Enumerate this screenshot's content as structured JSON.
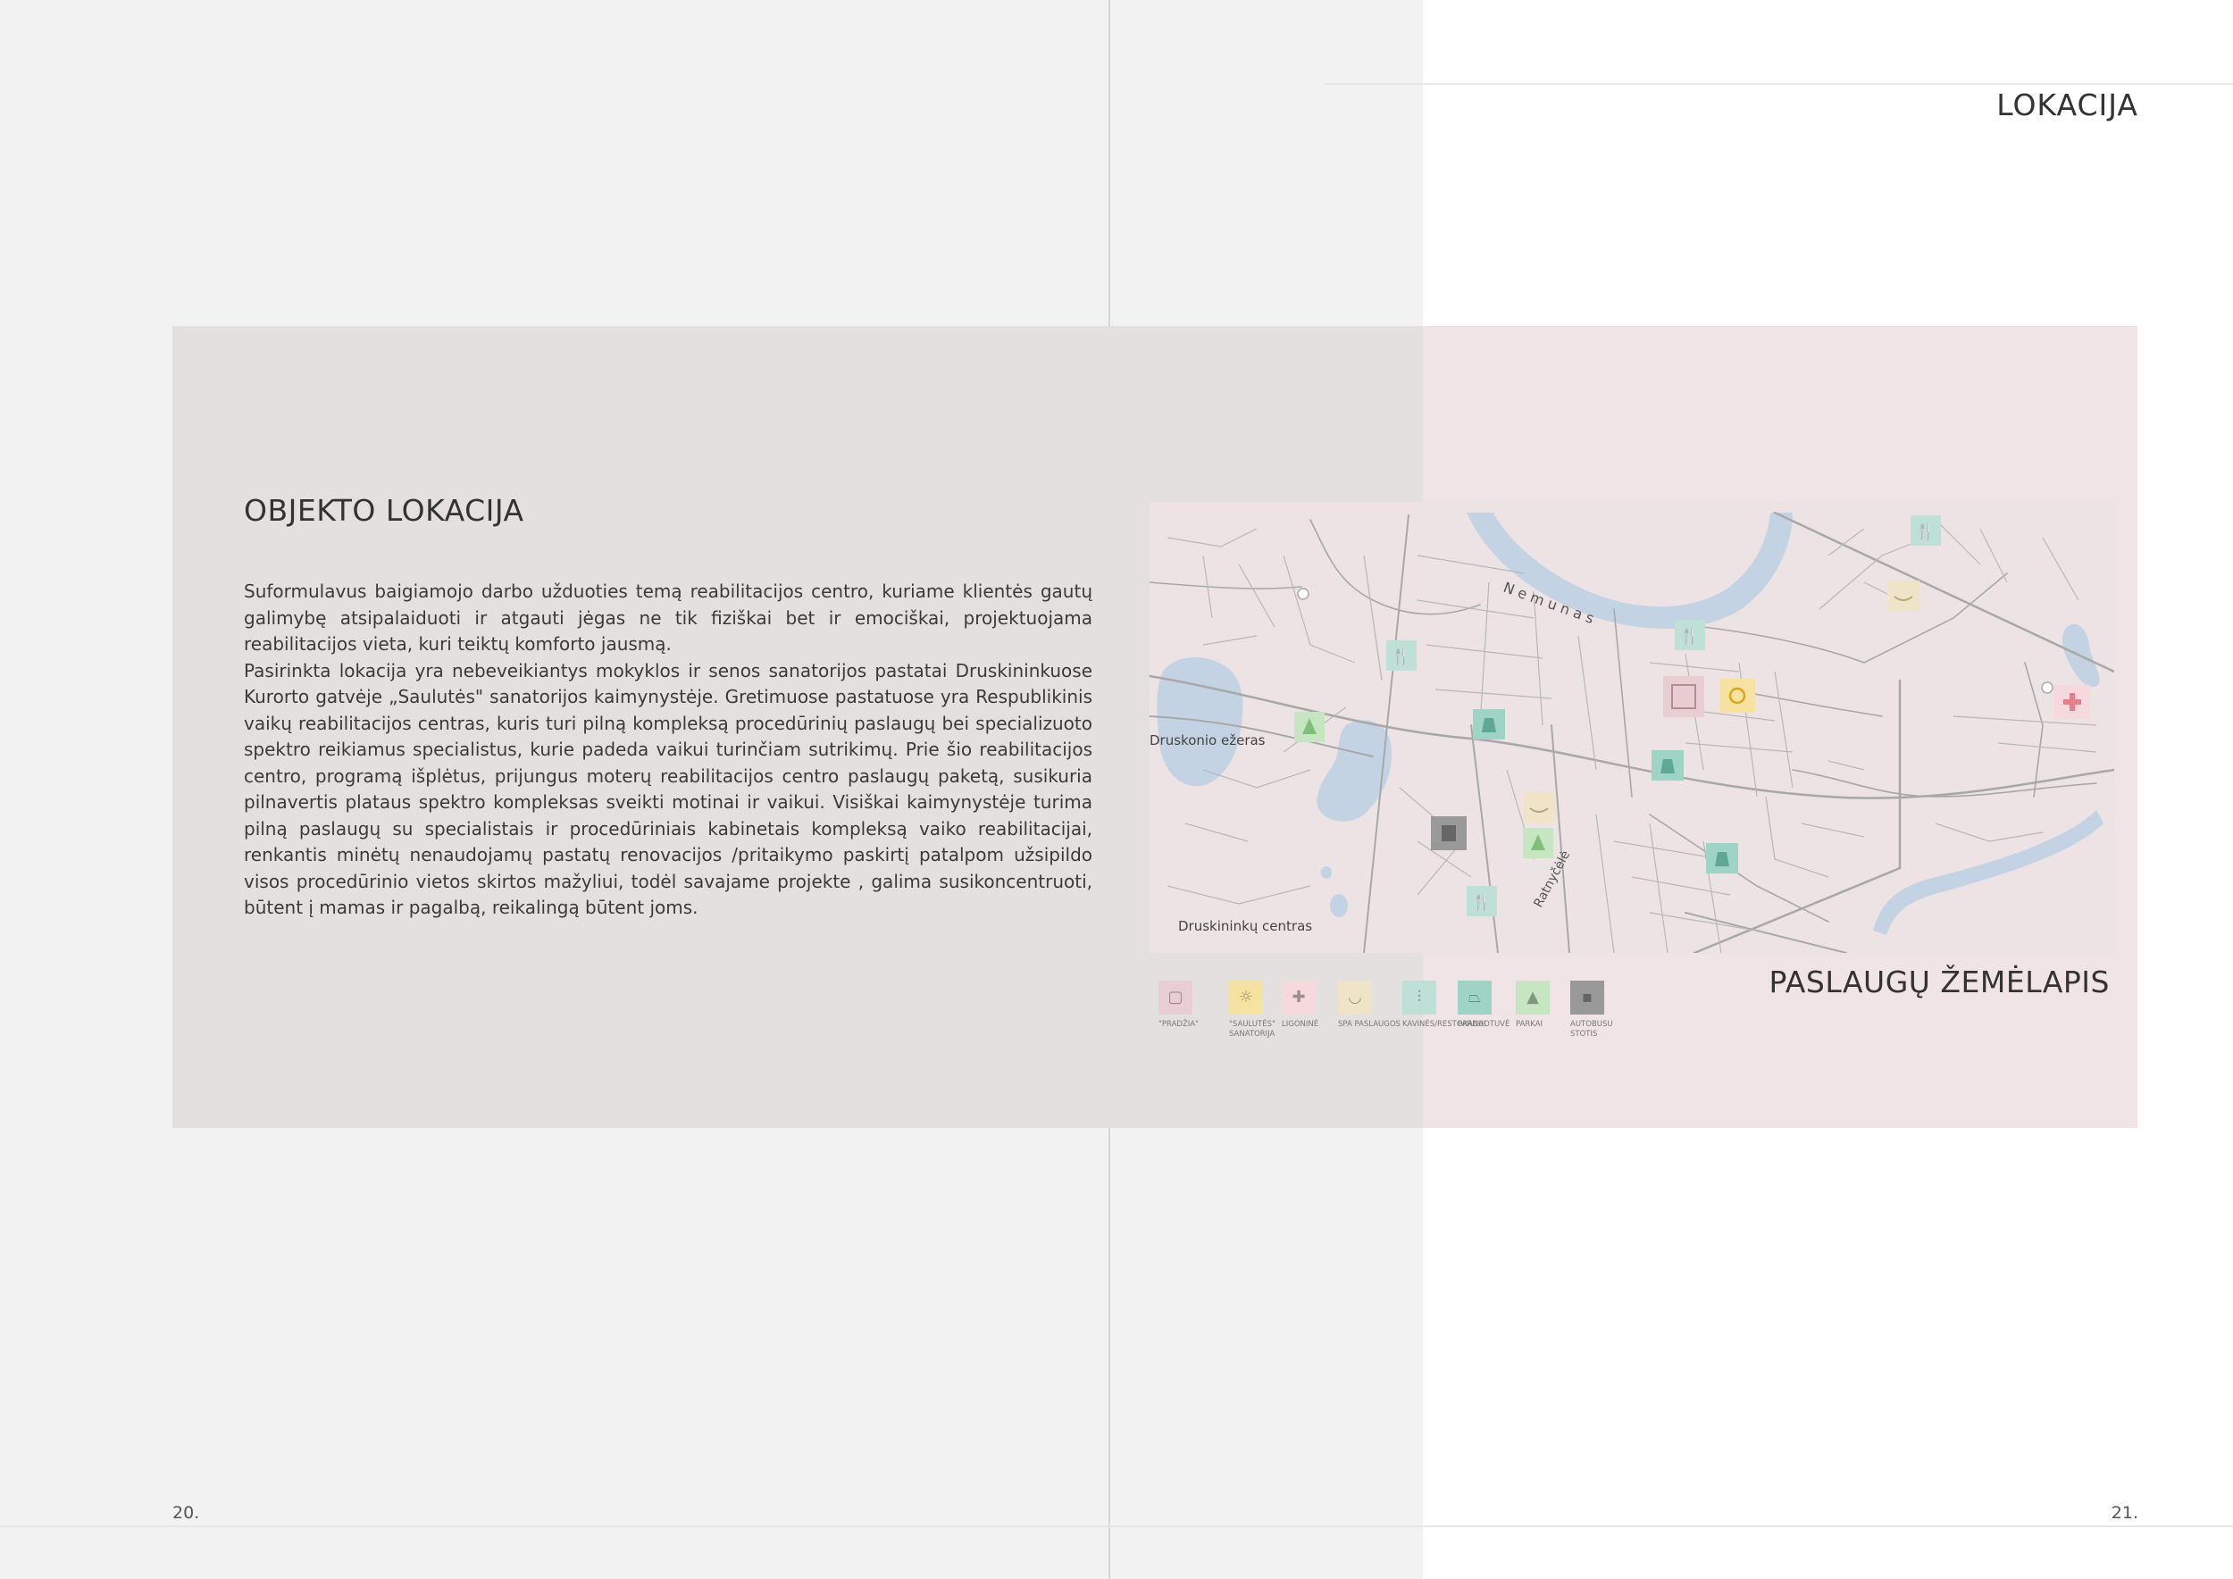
{
  "header": {
    "section_title": "LOKACIJA"
  },
  "left_page": {
    "title": "OBJEKTO LOKACIJA",
    "paragraph_1": "Suformulavus baigiamojo darbo užduoties temą reabilitacijos centro, kuriame klientės gautų galimybę atsipalaiduoti ir atgauti jėgas ne tik fiziškai bet ir emociškai, projektuojama reabilitacijos vieta, kuri teiktų komforto jausmą.",
    "paragraph_2": "Pasirinkta lokacija yra nebeveikiantys mokyklos ir senos sanatorijos pastatai Druskininkuose Kurorto gatvėje „Saulutės\" sanatorijos kaimynystėje. Gretimuose pastatuose yra Respublikinis vaikų reabilitacijos centras, kuris turi pilną kompleksą procedūrinių paslaugų bei specializuoto spektro reikiamus specialistus, kurie padeda vaikui turinčiam sutrikimų. Prie šio reabilitacijos centro, programą išplėtus, prijungus moterų reabilitacijos centro paslaugų paketą, susikuria pilnavertis plataus spektro kompleksas sveikti motinai ir vaikui. Visiškai kaimynystėje turima pilną paslaugų su specialistais ir procedūriniais kabinetais kompleksą vaiko reabilitacijai, renkantis minėtų nenaudojamų pastatų renovacijos /pritaikymo paskirtį patalpom užsipildo visos procedūrinio vietos skirtos mažyliui, todėl savajame projekte , galima susikoncentruoti, būtent į mamas ir pagalbą, reikalingą būtent joms.",
    "page_number": "20."
  },
  "right_page": {
    "map_title": "PASLAUGŲ ŽEMĖLAPIS",
    "page_number": "21."
  },
  "map": {
    "labels": {
      "river": "N e m u n a s",
      "lake": "Druskonio ežeras",
      "center": "Druskininkų centras",
      "stream": "Ratnyčėlė"
    },
    "legend": [
      {
        "label": "\"PRADŽIA\"",
        "icon": "building-icon",
        "color": "#e8cdd2"
      },
      {
        "label": "\"SAULUTĖS\" SANATORIJA",
        "icon": "sun-icon",
        "color": "#f6e3a2"
      },
      {
        "label": "LIGONINĖ",
        "icon": "cross-icon",
        "color": "#f6d9dc"
      },
      {
        "label": "SPA PASLAUGOS",
        "icon": "eye-icon",
        "color": "#efe4c8"
      },
      {
        "label": "KAVINĖS/RESTORANAI",
        "icon": "cutlery-icon",
        "color": "#bfe0d6"
      },
      {
        "label": "PARDUOTUVĖ",
        "icon": "bag-icon",
        "color": "#9ed4c6"
      },
      {
        "label": "PARKAI",
        "icon": "tree-icon",
        "color": "#c6e6c2"
      },
      {
        "label": "AUTOBUSU STOTIS",
        "icon": "bus-icon",
        "color": "#999999"
      }
    ]
  }
}
